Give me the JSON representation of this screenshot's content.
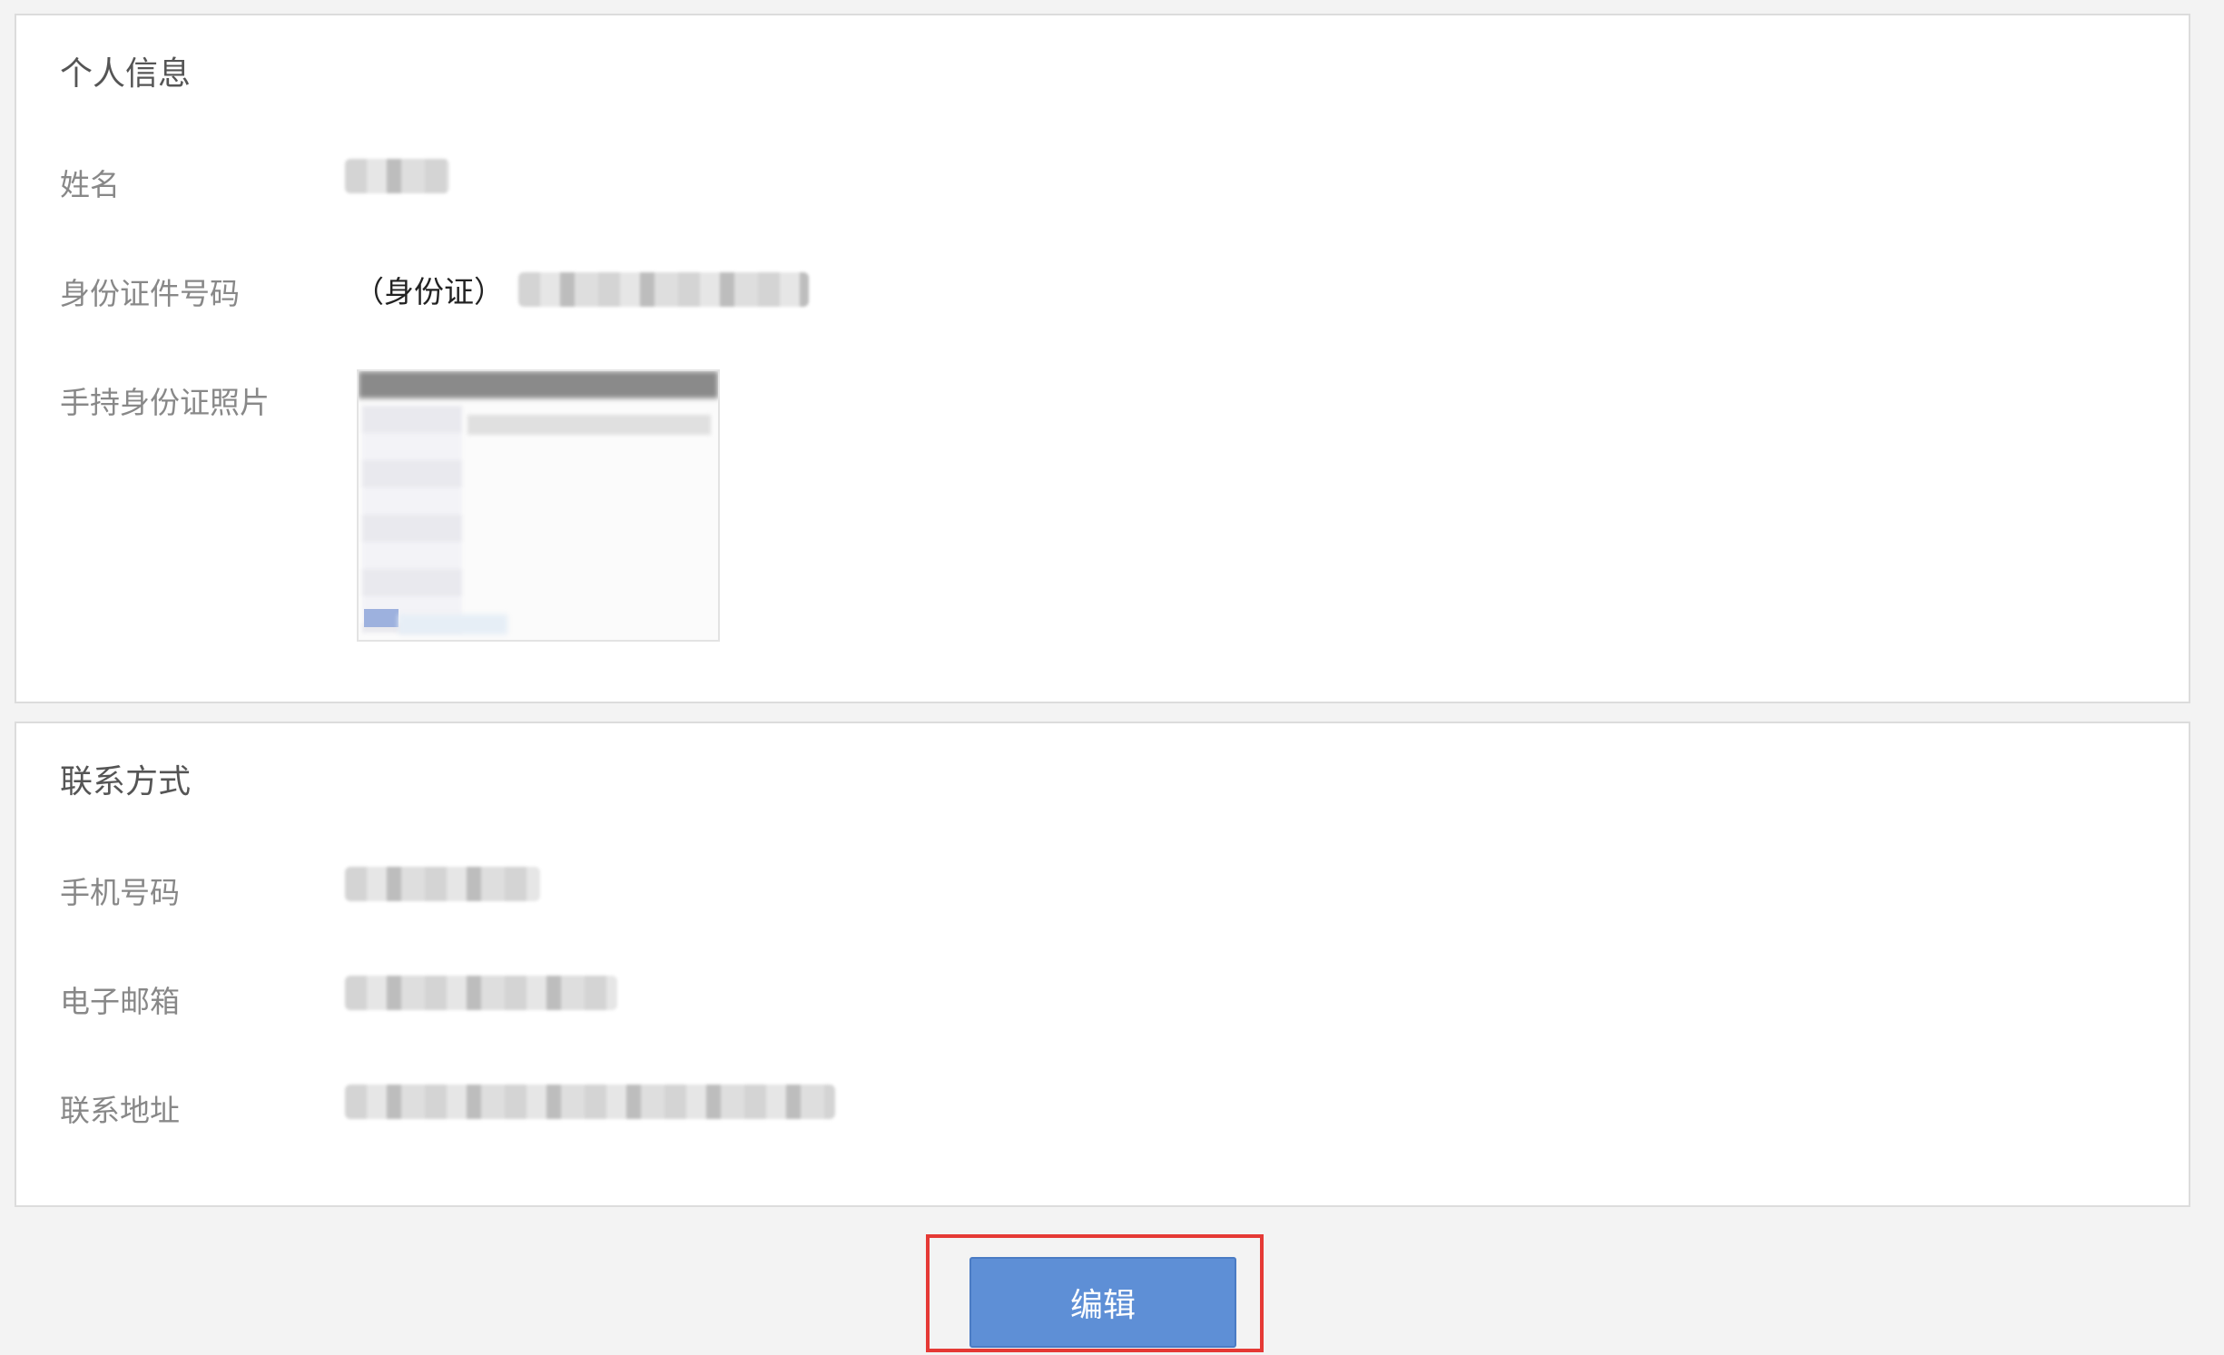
{
  "personal_info": {
    "title": "个人信息",
    "name_label": "姓名",
    "id_label": "身份证件号码",
    "id_prefix": "（身份证）",
    "photo_label": "手持身份证照片"
  },
  "contact_info": {
    "title": "联系方式",
    "phone_label": "手机号码",
    "email_label": "电子邮箱",
    "address_label": "联系地址"
  },
  "actions": {
    "edit_label": "编辑"
  }
}
